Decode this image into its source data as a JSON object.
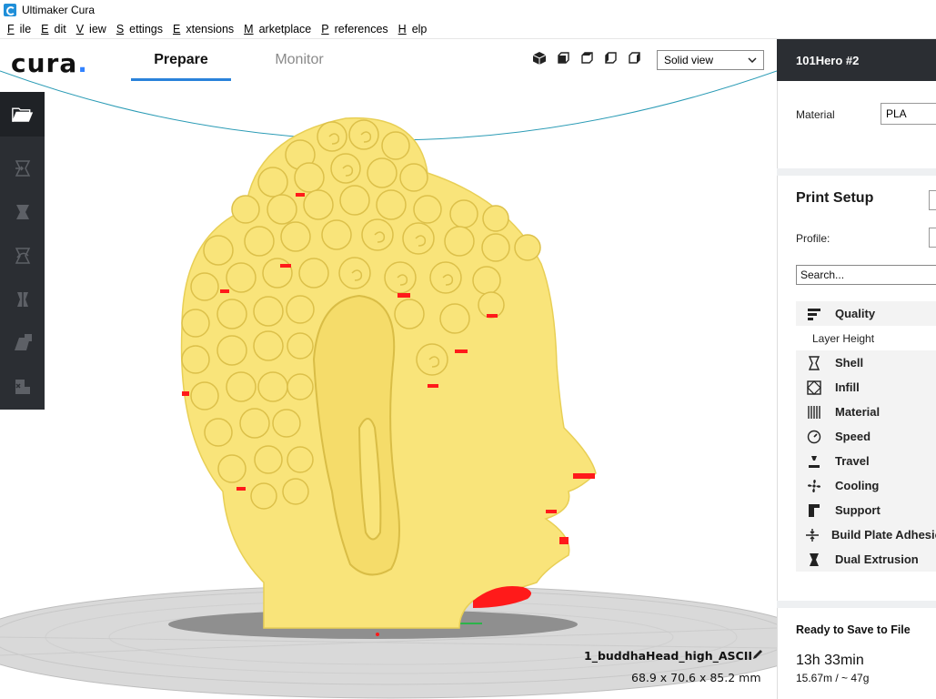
{
  "window": {
    "title": "Ultimaker Cura"
  },
  "menu": {
    "items": [
      {
        "label": "File",
        "ul": "F",
        "rest": "ile"
      },
      {
        "label": "Edit",
        "ul": "E",
        "rest": "dit"
      },
      {
        "label": "View",
        "ul": "V",
        "rest": "iew"
      },
      {
        "label": "Settings",
        "ul": "S",
        "rest": "ettings"
      },
      {
        "label": "Extensions",
        "ul": "E",
        "rest": "xtensions"
      },
      {
        "label": "Marketplace",
        "ul": "M",
        "rest": "arketplace"
      },
      {
        "label": "Preferences",
        "ul": "P",
        "rest": "references"
      },
      {
        "label": "Help",
        "ul": "H",
        "rest": "elp"
      }
    ]
  },
  "header": {
    "logo": "cura",
    "tabs": {
      "prepare": "Prepare",
      "monitor": "Monitor"
    },
    "view_mode": "Solid view"
  },
  "model": {
    "name": "1_buddhaHead_high_ASCII",
    "dimensions": "68.9 x 70.6 x 85.2 mm"
  },
  "sidebar": {
    "printer_name": "101Hero #2",
    "material_label": "Material",
    "material_value": "PLA",
    "print_setup_title": "Print Setup",
    "profile_label": "Profile:",
    "search_placeholder": "Search...",
    "categories": {
      "quality": "Quality",
      "layer_height": "Layer Height",
      "shell": "Shell",
      "infill": "Infill",
      "material": "Material",
      "speed": "Speed",
      "travel": "Travel",
      "cooling": "Cooling",
      "support": "Support",
      "build_plate": "Build Plate Adhesion",
      "dual_extrusion": "Dual Extrusion"
    }
  },
  "status": {
    "ready": "Ready to Save to File",
    "time": "13h 33min",
    "amount": "15.67m / ~ 47g"
  },
  "colors": {
    "accent": "#2a82da",
    "model": "#f9e47a",
    "overhang": "#ff0000",
    "dark": "#2b2e33"
  }
}
